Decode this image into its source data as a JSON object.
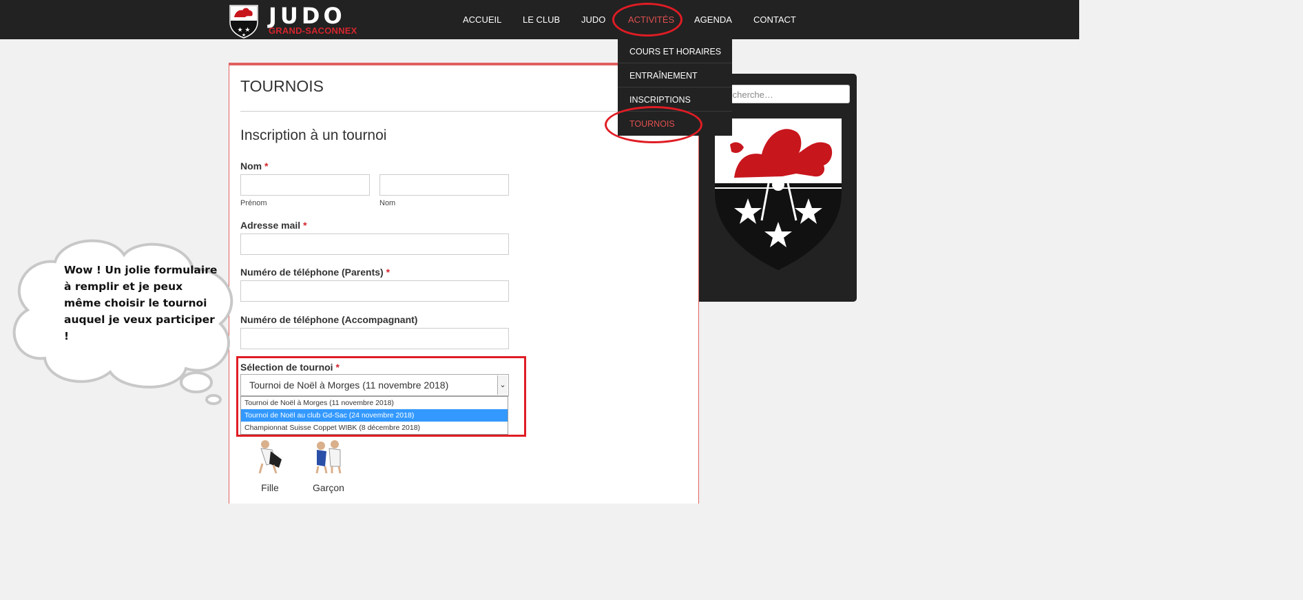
{
  "header": {
    "logo_word": "JUDO",
    "logo_sub": "GRAND-SACONNEX",
    "nav": [
      "ACCUEIL",
      "LE CLUB",
      "JUDO",
      "ACTIVITÉS",
      "AGENDA",
      "CONTACT"
    ],
    "active_nav": "ACTIVITÉS"
  },
  "dropdown": {
    "items": [
      "COURS ET HORAIRES",
      "ENTRAÎNEMENT",
      "INSCRIPTIONS",
      "TOURNOIS"
    ],
    "active_item": "TOURNOIS"
  },
  "main": {
    "page_title": "TOURNOIS",
    "form_title": "Inscription à un tournoi",
    "required_mark": "*",
    "fields": {
      "name_label": "Nom",
      "first_name_sub": "Prénom",
      "last_name_sub": "Nom",
      "email_label": "Adresse mail",
      "phone_parents_label": "Numéro de téléphone (Parents)",
      "phone_companion_label": "Numéro de téléphone (Accompagnant)",
      "tournament_label": "Sélection de tournoi"
    },
    "tournament_select": {
      "selected": "Tournoi de Noël à Morges (11 novembre 2018)",
      "options": [
        "Tournoi de Noël à Morges (11 novembre 2018)",
        "Tournoi de Noël au club Gd-Sac (24 novembre 2018)",
        "Championnat Suisse Coppet WIBK (8 décembre 2018)"
      ],
      "highlighted_option": "Tournoi de Noël au club Gd-Sac (24 novembre 2018)"
    },
    "gender": {
      "girl_label": "Fille",
      "boy_label": "Garçon"
    }
  },
  "sidebar": {
    "search_placeholder": "Recherche…"
  },
  "annotation": {
    "cloud_text": "Wow ! Un jolie formulaire à remplir et je peux même choisir le tournoi auquel je veux participer !"
  },
  "colors": {
    "brand_red": "#d4252c",
    "header_bg": "#222222",
    "active_link": "#e05050",
    "selection_blue": "#3399ff"
  }
}
